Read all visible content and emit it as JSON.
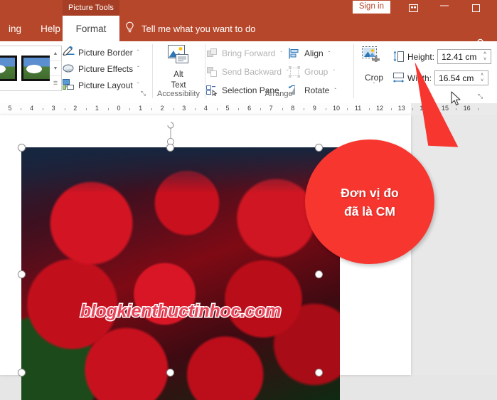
{
  "titlebar": {
    "contextual_tab": "Picture Tools",
    "signin": "Sign in",
    "ribbon_display_icon": "ribbon-display-options-icon",
    "minimize_icon": "minimize-icon",
    "maximize_icon": "maximize-icon",
    "accent_color": "#b7472a",
    "contextual_color": "#a63f25"
  },
  "tabs": [
    {
      "label": "ing",
      "name": "tab-drawing",
      "active": false
    },
    {
      "label": "Help",
      "name": "tab-help",
      "active": false
    },
    {
      "label": "Format",
      "name": "tab-format",
      "active": true
    }
  ],
  "tellme": {
    "placeholder": "Tell me what you want to do",
    "icon": "lightbulb-icon"
  },
  "account": {
    "icon": "account-person-icon"
  },
  "ribbon": {
    "picture_styles": {
      "group_label": "",
      "scroll_up": "▲",
      "scroll_down": "▼",
      "more": "☰"
    },
    "picture_commands": [
      {
        "label": "Picture Border",
        "icon": "picture-border-icon",
        "caret": "ˇ"
      },
      {
        "label": "Picture Effects",
        "icon": "picture-effects-icon",
        "caret": "ˇ"
      },
      {
        "label": "Picture Layout",
        "icon": "picture-layout-icon",
        "caret": "ˇ"
      }
    ],
    "styles_dialog_launcher": "⤡",
    "accessibility": {
      "group_label": "Accessibility",
      "alt_text_line1": "Alt",
      "alt_text_line2": "Text",
      "icon": "alt-text-picture-icon"
    },
    "arrange": {
      "group_label": "Arrange",
      "items": [
        {
          "label": "Bring Forward",
          "icon": "bring-forward-icon",
          "caret": "ˇ",
          "disabled": true
        },
        {
          "label": "Send Backward",
          "icon": "send-backward-icon",
          "caret": "ˇ",
          "disabled": true
        },
        {
          "label": "Selection Pane",
          "icon": "selection-pane-icon",
          "caret": "",
          "disabled": false
        },
        {
          "label": "Align",
          "icon": "align-icon",
          "caret": "ˇ",
          "disabled": false
        },
        {
          "label": "Group",
          "icon": "group-icon",
          "caret": "ˇ",
          "disabled": true
        },
        {
          "label": "Rotate",
          "icon": "rotate-icon",
          "caret": "ˇ",
          "disabled": false
        }
      ]
    },
    "size": {
      "group_label": "",
      "crop_label": "Crop",
      "crop_icon": "crop-icon",
      "crop_caret": "ˇ",
      "height_label": "Height:",
      "height_value": "12.41 cm",
      "height_icon": "shape-height-icon",
      "width_label": "Width:",
      "width_value": "16.54 cm",
      "width_icon": "shape-width-icon",
      "spin_up": "˄",
      "spin_down": "˅",
      "dialog_launcher": "⤡"
    }
  },
  "ruler": {
    "ticks": [
      "5",
      "4",
      "3",
      "2",
      "1",
      "0",
      "1",
      "2",
      "3",
      "4",
      "5",
      "6",
      "7",
      "8",
      "9",
      "10",
      "11",
      "12",
      "13",
      "14",
      "15",
      "16"
    ]
  },
  "callout": {
    "line1": "Đơn vị đo",
    "line2": "đã là CM",
    "color": "#f7362f"
  },
  "slide": {
    "picture_name": "red-roses-photo",
    "watermark": "blogkienthuctinhoc.com",
    "rotation_handle": "rotate-handle",
    "handle_name": "resize-handle"
  },
  "cursor": {
    "name": "mouse-pointer"
  }
}
